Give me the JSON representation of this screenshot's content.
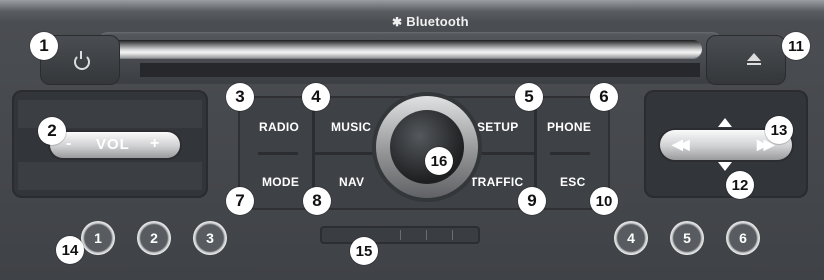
{
  "header": {
    "bluetooth_label": "Bluetooth"
  },
  "buttons": {
    "radio": "RADIO",
    "music": "MUSIC",
    "setup": "SETUP",
    "phone": "PHONE",
    "mode": "MODE",
    "nav": "NAV",
    "traffic": "TRAFFIC",
    "esc": "ESC"
  },
  "volume": {
    "label": "VOL",
    "minus": "-",
    "plus": "+"
  },
  "presets": [
    "1",
    "2",
    "3",
    "4",
    "5",
    "6"
  ],
  "callouts": {
    "power": "1",
    "volume": "2",
    "radio": "3",
    "music": "4",
    "setup": "5",
    "phone": "6",
    "mode": "7",
    "nav": "8",
    "traffic": "9",
    "esc": "10",
    "eject": "11",
    "nav_down": "12",
    "nav_right": "13",
    "presets": "14",
    "slot": "15",
    "knob": "16"
  },
  "icons": {
    "power": "power-icon",
    "eject": "eject-icon",
    "bluetooth": "bluetooth-icon",
    "up": "arrow-up-icon",
    "down": "arrow-down-icon",
    "rewind": "rewind-icon",
    "forward": "fast-forward-icon"
  }
}
